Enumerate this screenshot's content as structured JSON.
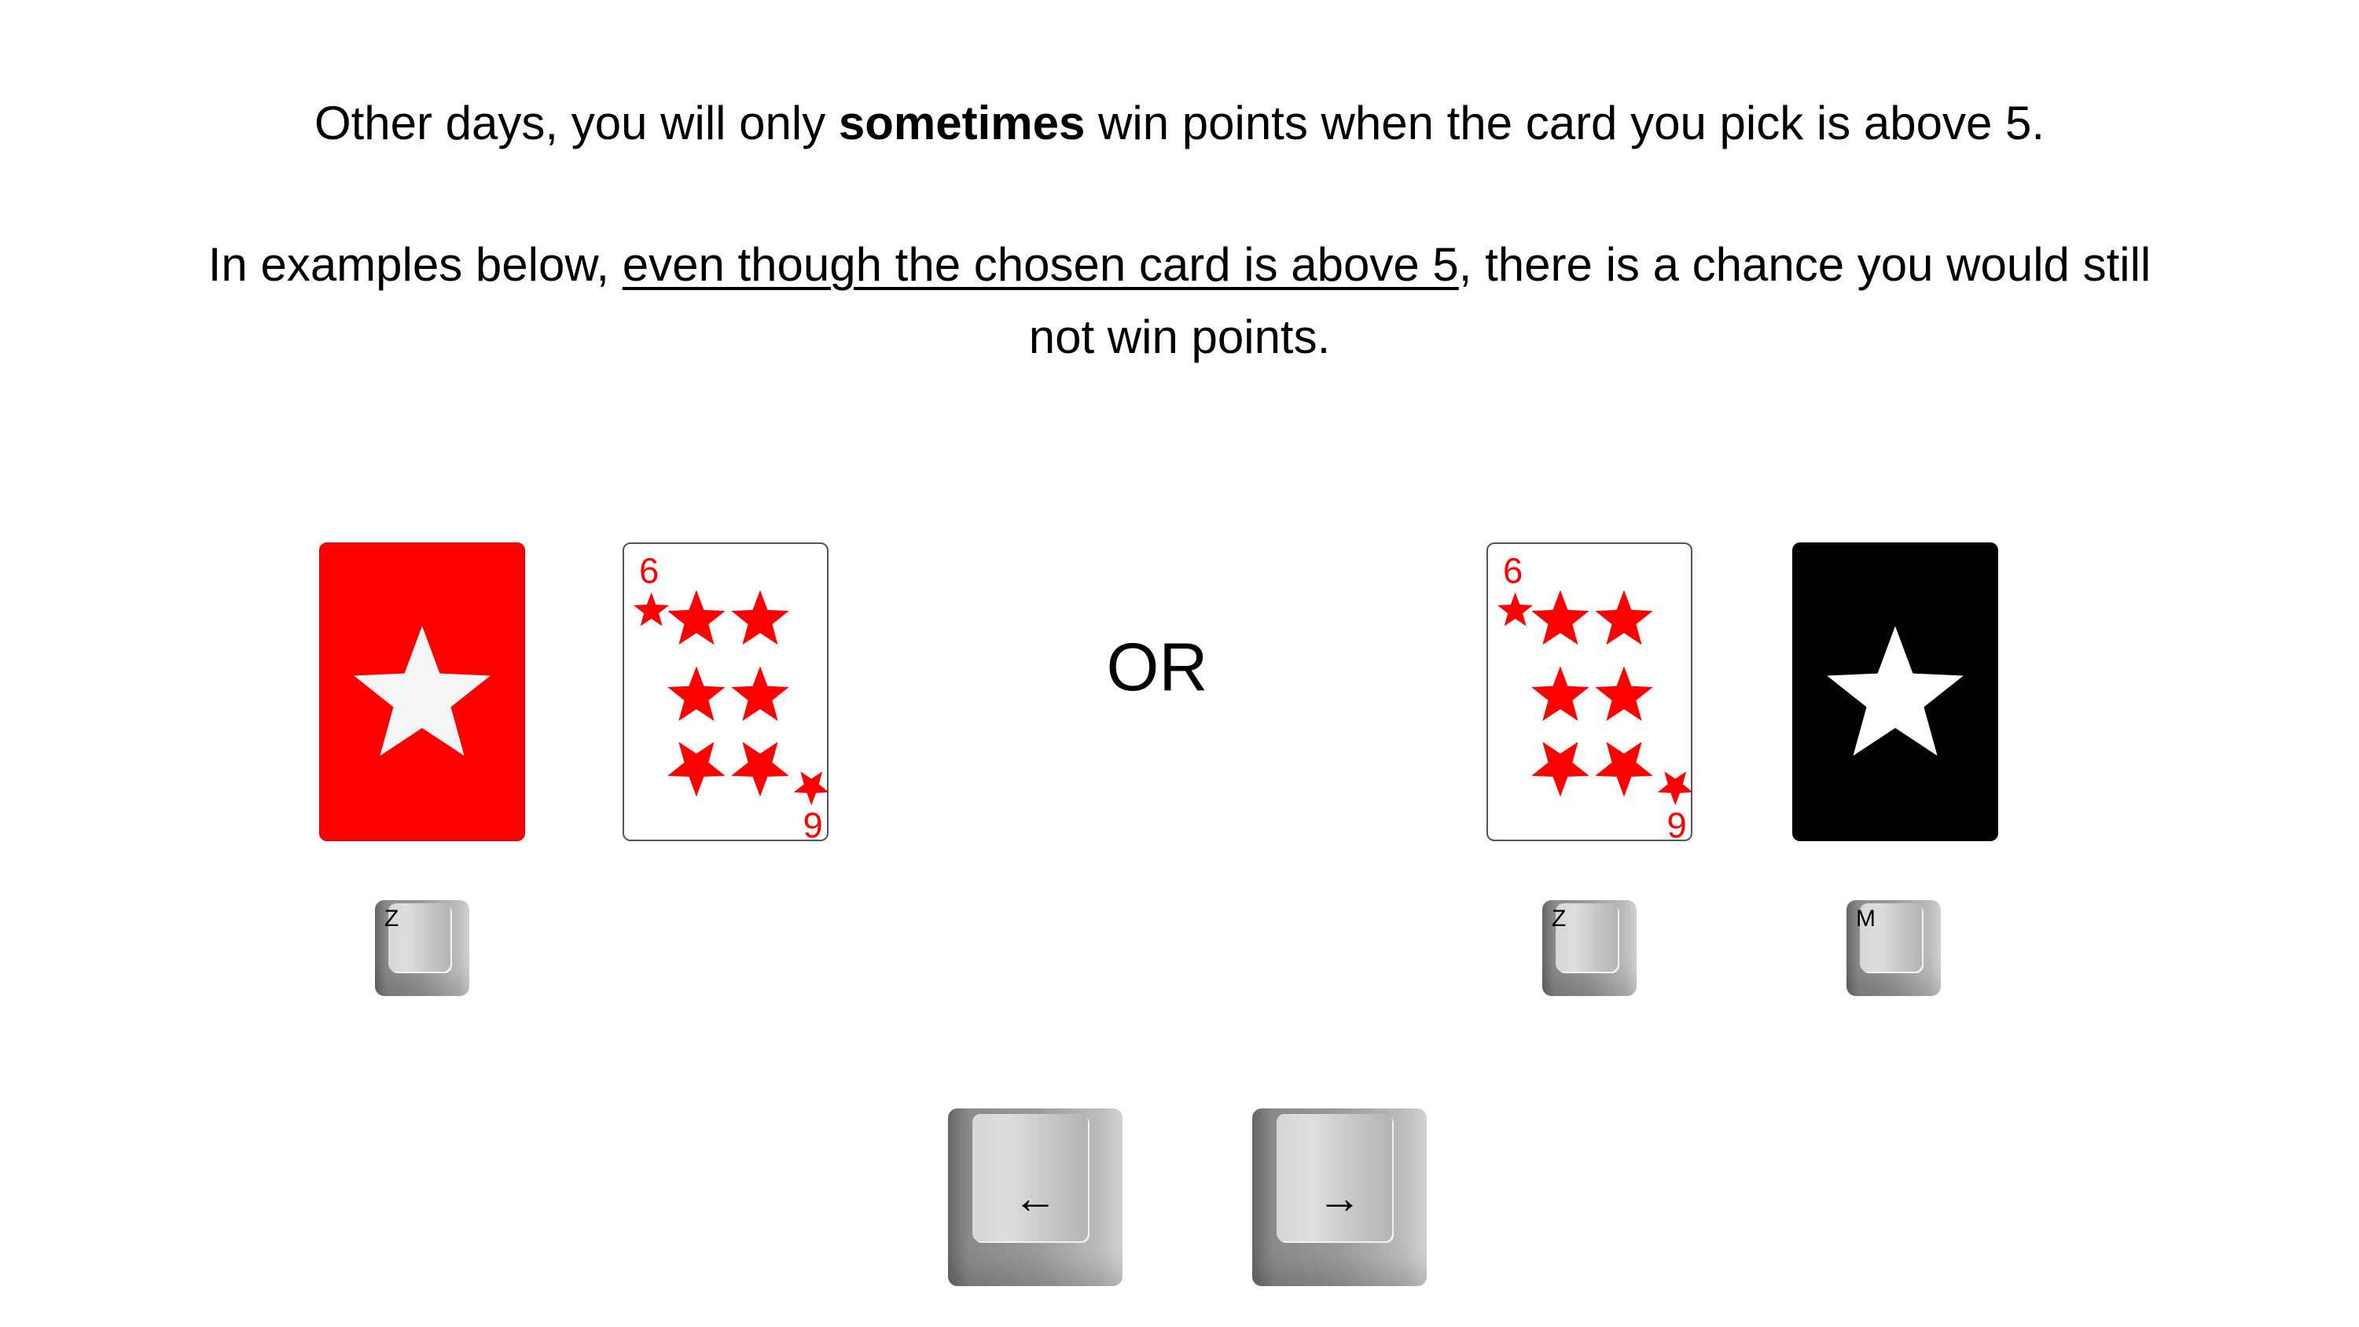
{
  "instructions": {
    "line1_prefix": "Other days, you will only ",
    "line1_bold": "sometimes",
    "line1_suffix": " win points when the card you pick is above 5.",
    "line2_prefix": "In examples below, ",
    "line2_underlined": "even though the chosen card is above 5",
    "line2_suffix": ", there is a chance you would still",
    "line3": "not win points."
  },
  "separator": "OR",
  "example_left": {
    "card_back": {
      "color": "#ff0000",
      "icon": "star-icon"
    },
    "card_face": {
      "rank_top": "6",
      "rank_bottom": "6",
      "suit": "star",
      "color": "#ff0000",
      "pips": 6
    },
    "key": "Z"
  },
  "example_right": {
    "card_face": {
      "rank_top": "6",
      "rank_bottom": "6",
      "suit": "star",
      "color": "#ff0000",
      "pips": 6
    },
    "card_back": {
      "color": "#000000",
      "icon": "star-icon"
    },
    "keys": [
      "Z",
      "M"
    ]
  },
  "navigation": {
    "left_key": "←",
    "right_key": "→"
  }
}
